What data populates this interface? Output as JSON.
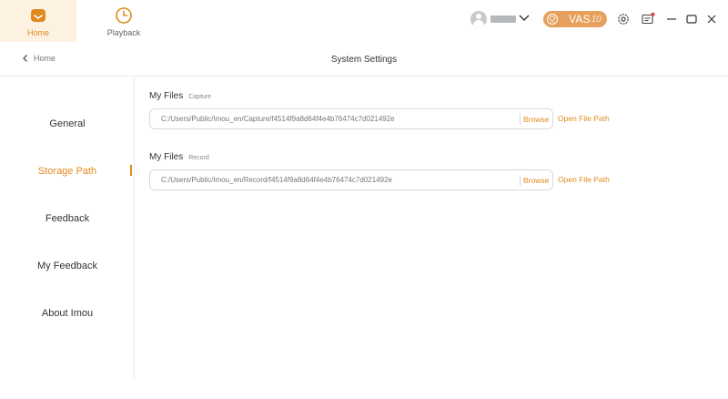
{
  "topnav": {
    "home_label": "Home",
    "playback_label": "Playback"
  },
  "header": {
    "vas_label": "VAS",
    "vas_sub": "10",
    "accent_color": "#e08a1e"
  },
  "subheader": {
    "back_label": "Home",
    "title": "System Settings"
  },
  "sidebar": {
    "items": [
      {
        "label": "General"
      },
      {
        "label": "Storage Path"
      },
      {
        "label": "Feedback"
      },
      {
        "label": "My Feedback"
      },
      {
        "label": "About Imou"
      }
    ]
  },
  "storage": {
    "capture": {
      "title": "My Files",
      "subtitle": "Capture",
      "path": "C:/Users/Public/Imou_en/Capture/f4514f9a8d64f4e4b76474c7d021492e",
      "browse_label": "Browse",
      "open_label": "Open File Path"
    },
    "record": {
      "title": "My Files",
      "subtitle": "Record",
      "path": "C:/Users/Public/Imou_en/Record/f4514f9a8d64f4e4b76474c7d021492e",
      "browse_label": "Browse",
      "open_label": "Open File Path"
    }
  }
}
